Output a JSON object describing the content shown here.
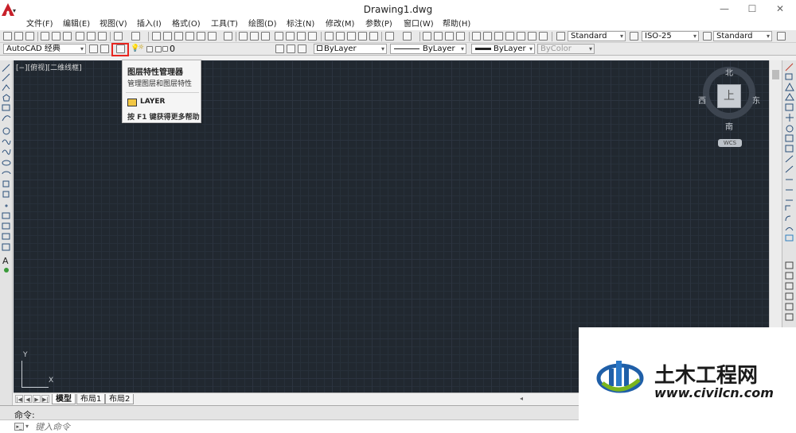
{
  "window": {
    "title": "Drawing1.dwg",
    "app_icon": "autocad-logo-icon",
    "controls": [
      "—",
      "☐",
      "✕"
    ]
  },
  "menu": [
    "文件(F)",
    "编辑(E)",
    "视图(V)",
    "插入(I)",
    "格式(O)",
    "工具(T)",
    "绘图(D)",
    "标注(N)",
    "修改(M)",
    "参数(P)",
    "窗口(W)",
    "帮助(H)"
  ],
  "toolbar": {
    "text_style": "Standard",
    "dim_style": "ISO-25",
    "table_style": "Standard",
    "workspace": "AutoCAD 经典",
    "layer": "0",
    "color": "ByLayer",
    "linetype": "ByLayer",
    "lineweight": "ByLayer",
    "plotstyle": "ByColor"
  },
  "tooltip": {
    "title": "图层特性管理器",
    "description": "管理图层和图层特性",
    "command": "LAYER",
    "help": "按 F1 键获得更多帮助"
  },
  "viewport": {
    "label": "[−][俯视][二维线框]"
  },
  "viewcube": {
    "north": "北",
    "south": "南",
    "east": "东",
    "west": "西",
    "face": "上",
    "wcs": "WCS"
  },
  "ucs": {
    "x": "X",
    "y": "Y"
  },
  "tabs": [
    "模型",
    "布局1",
    "布局2"
  ],
  "command": {
    "label": "命令:",
    "placeholder": "键入命令"
  },
  "watermark": {
    "name": "土木工程网",
    "url": "www.civilcn.com"
  },
  "colors": {
    "canvas": "#212830",
    "highlight": "#e8261f",
    "autocad_red": "#c8202a"
  }
}
